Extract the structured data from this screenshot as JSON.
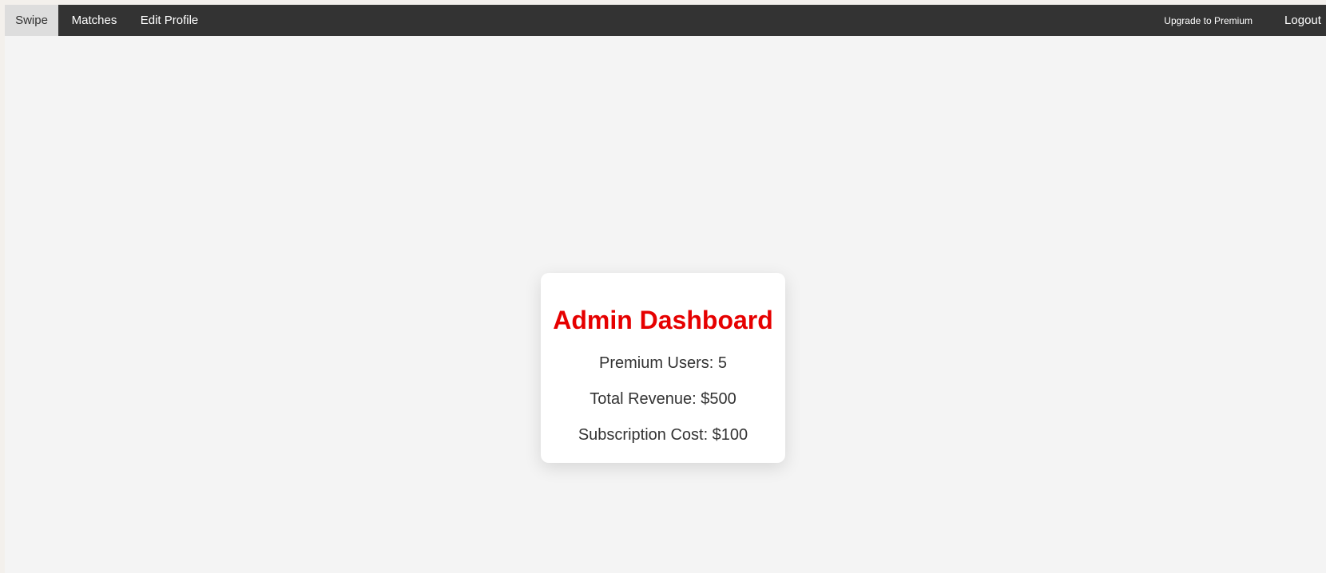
{
  "navbar": {
    "left_items": [
      {
        "label": "Swipe",
        "active": true
      },
      {
        "label": "Matches"
      },
      {
        "label": "Edit Profile"
      }
    ],
    "right_items": [
      {
        "label": "Upgrade to Premium"
      },
      {
        "label": "Logout"
      }
    ],
    "colors": {
      "background": "#333333",
      "active_background": "#dddddd"
    }
  },
  "dashboard": {
    "title": "Admin Dashboard",
    "premium_users": "Premium Users: 5",
    "total_revenue": "Total Revenue: $500",
    "subscription_cost": "Subscription Cost: $100",
    "title_color": "#e60000"
  }
}
